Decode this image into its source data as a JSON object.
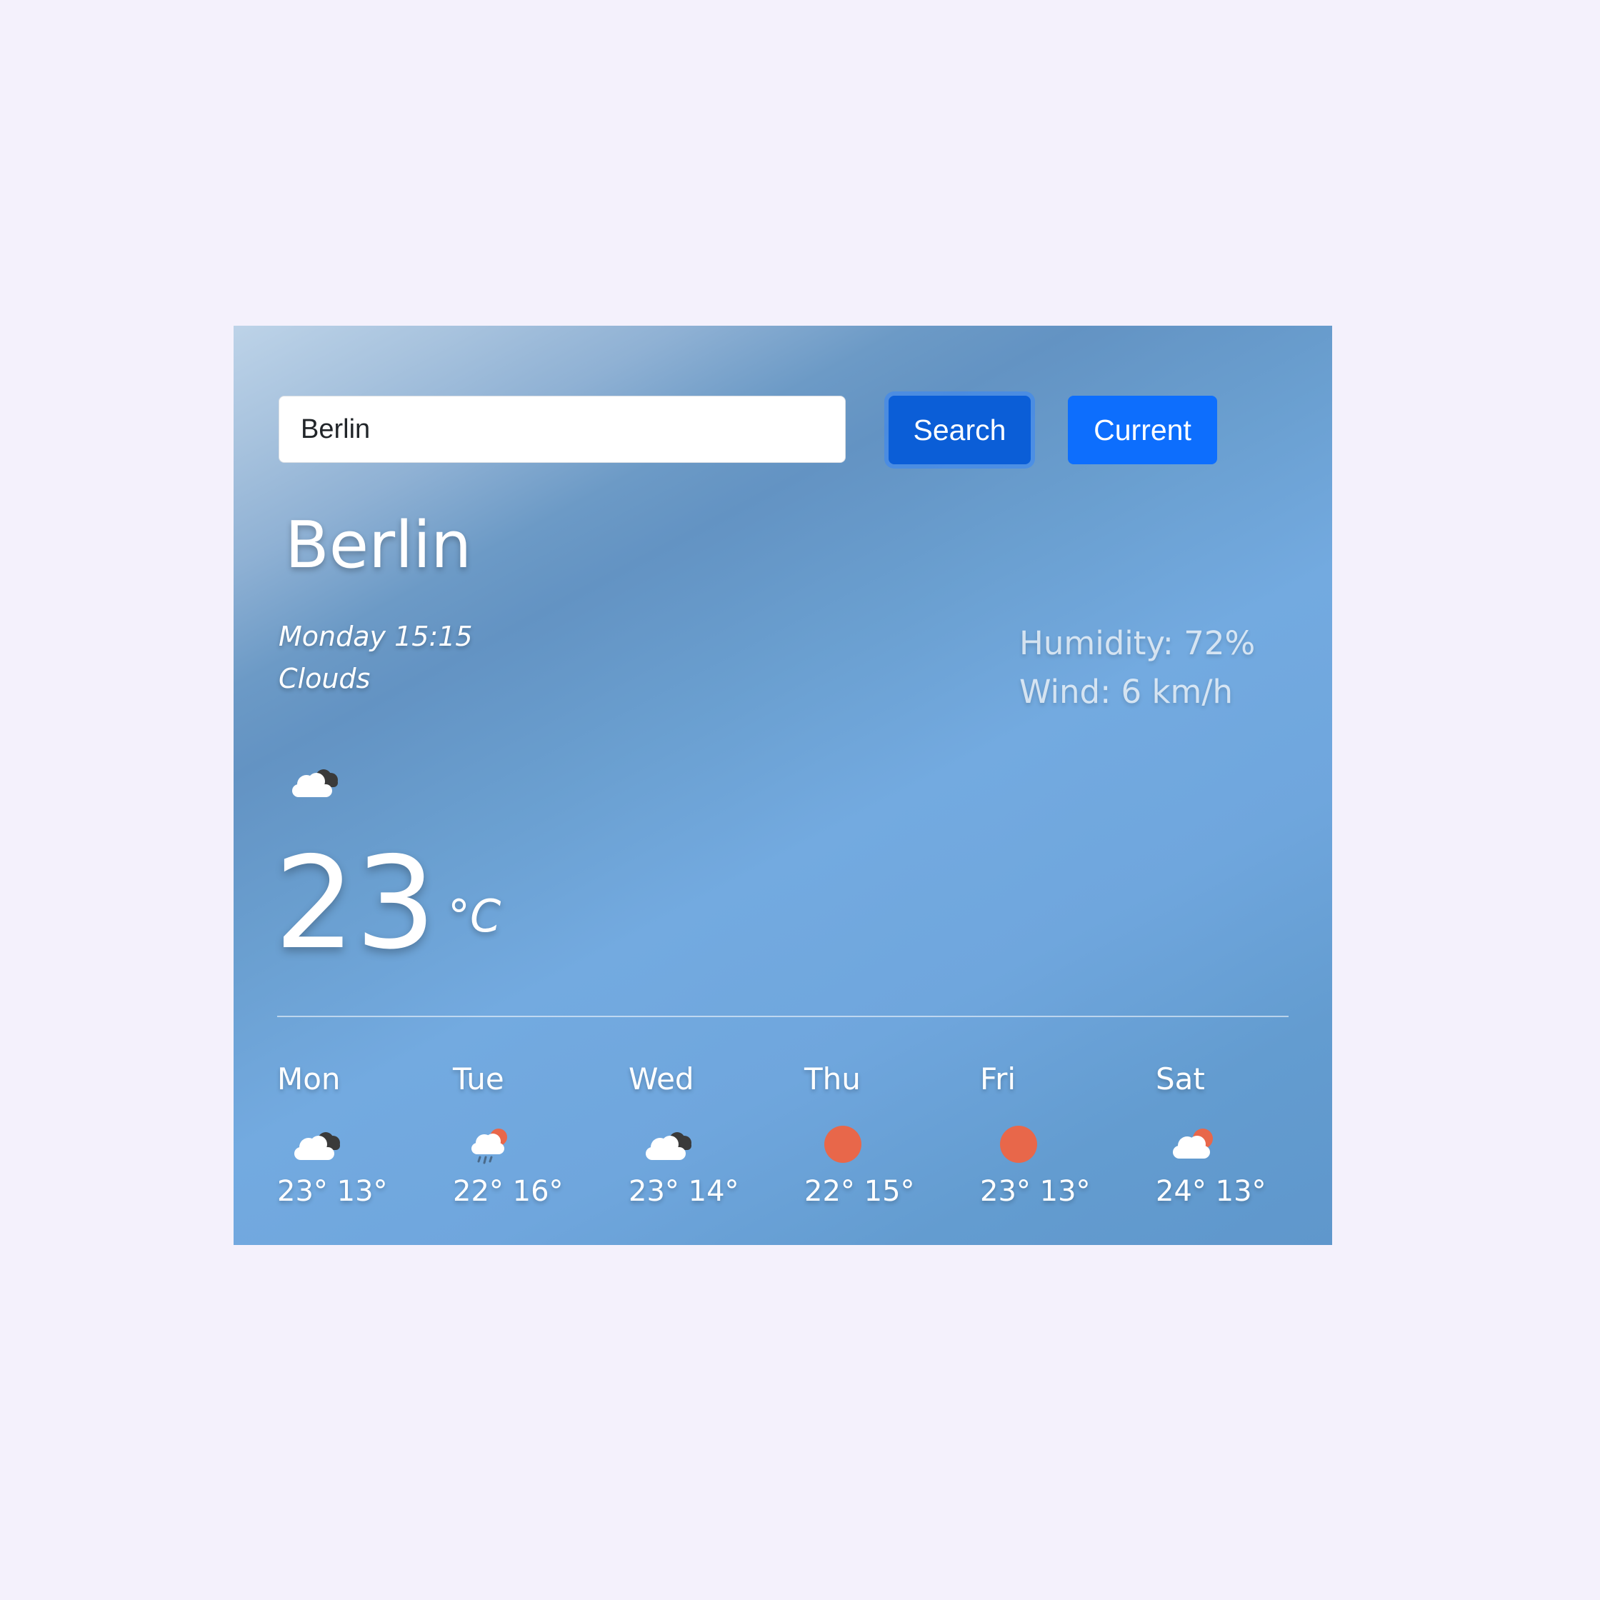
{
  "search": {
    "input_value": "Berlin",
    "search_label": "Search",
    "current_label": "Current"
  },
  "current": {
    "city": "Berlin",
    "datetime": "Monday 15:15",
    "description": "Clouds",
    "icon": "broken-clouds-icon",
    "temperature": "23",
    "unit": "°C",
    "humidity": "Humidity: 72%",
    "wind": "Wind: 6 km/h"
  },
  "forecast": [
    {
      "day": "Mon",
      "icon": "broken-clouds-icon",
      "high": "23°",
      "low": "13°"
    },
    {
      "day": "Tue",
      "icon": "rain-icon",
      "high": "22°",
      "low": "16°"
    },
    {
      "day": "Wed",
      "icon": "broken-clouds-icon",
      "high": "23°",
      "low": "14°"
    },
    {
      "day": "Thu",
      "icon": "sun-icon",
      "high": "22°",
      "low": "15°"
    },
    {
      "day": "Fri",
      "icon": "sun-icon",
      "high": "23°",
      "low": "13°"
    },
    {
      "day": "Sat",
      "icon": "partly-cloudy-icon",
      "high": "24°",
      "low": "13°"
    }
  ],
  "colors": {
    "page_background": "#f4f1fc",
    "button_primary": "#0d6efd",
    "button_active": "#0b5ed7",
    "sun": "#e8674a"
  }
}
